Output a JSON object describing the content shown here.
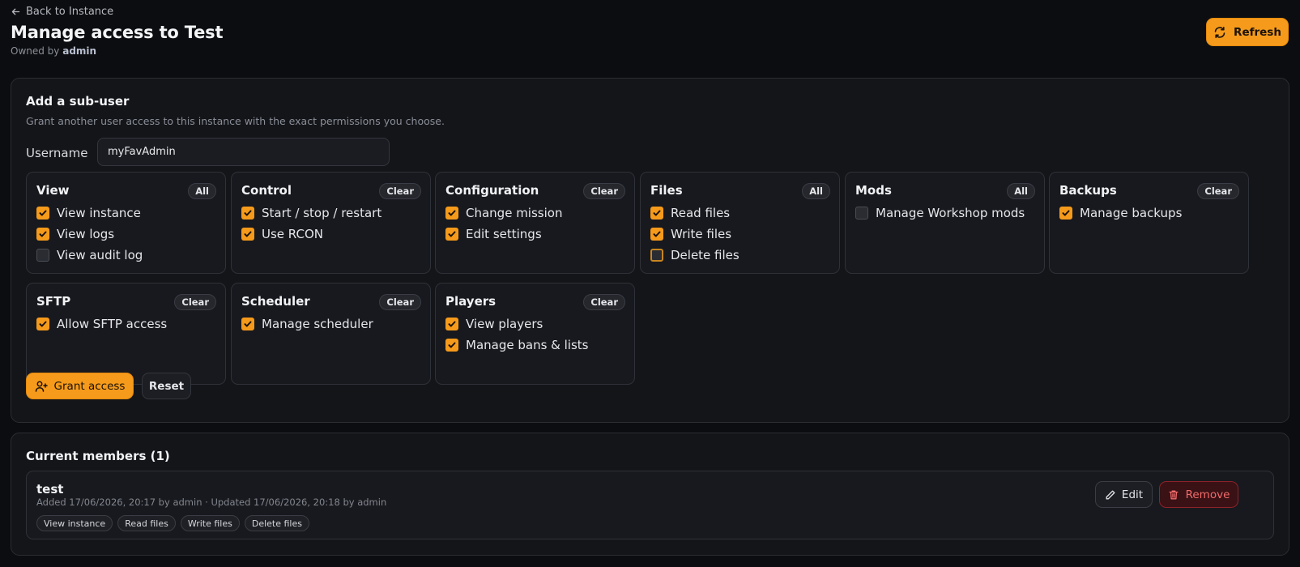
{
  "header": {
    "back_label": "Back to Instance",
    "title": "Manage access to Test",
    "owner_prefix": "Owned by",
    "owner_name": "admin",
    "refresh_label": "Refresh"
  },
  "colors": {
    "accent": "#f59a1b",
    "background": "#0c0d10",
    "danger": "#f26b6b"
  },
  "add_subuser": {
    "title": "Add a sub-user",
    "description": "Grant another user access to this instance with the exact permissions you choose.",
    "username_label": "Username",
    "username_value": "myFavAdmin",
    "grant_label": "Grant access",
    "reset_label": "Reset"
  },
  "permission_groups": [
    {
      "title": "View",
      "action": "All",
      "items": [
        {
          "label": "View instance",
          "checked": true
        },
        {
          "label": "View logs",
          "checked": true
        },
        {
          "label": "View audit log",
          "checked": false
        }
      ]
    },
    {
      "title": "Control",
      "action": "Clear",
      "items": [
        {
          "label": "Start / stop / restart",
          "checked": true
        },
        {
          "label": "Use RCON",
          "checked": true
        }
      ]
    },
    {
      "title": "Configuration",
      "action": "Clear",
      "items": [
        {
          "label": "Change mission",
          "checked": true
        },
        {
          "label": "Edit settings",
          "checked": true
        }
      ]
    },
    {
      "title": "Files",
      "action": "All",
      "items": [
        {
          "label": "Read files",
          "checked": true
        },
        {
          "label": "Write files",
          "checked": true
        },
        {
          "label": "Delete files",
          "checked": false
        }
      ]
    },
    {
      "title": "Mods",
      "action": "All",
      "items": [
        {
          "label": "Manage Workshop mods",
          "checked": false
        }
      ]
    },
    {
      "title": "Backups",
      "action": "Clear",
      "items": [
        {
          "label": "Manage backups",
          "checked": true
        }
      ]
    },
    {
      "title": "SFTP",
      "action": "Clear",
      "items": [
        {
          "label": "Allow SFTP access",
          "checked": true
        }
      ]
    },
    {
      "title": "Scheduler",
      "action": "Clear",
      "items": [
        {
          "label": "Manage scheduler",
          "checked": true
        }
      ]
    },
    {
      "title": "Players",
      "action": "Clear",
      "items": [
        {
          "label": "View players",
          "checked": true
        },
        {
          "label": "Manage bans & lists",
          "checked": true
        }
      ]
    }
  ],
  "members": {
    "title": "Current members (1)",
    "list": [
      {
        "name": "test",
        "meta": "Added 17/06/2026, 20:17 by admin · Updated 17/06/2026, 20:18 by admin",
        "tags": [
          "View instance",
          "Read files",
          "Write files",
          "Delete files"
        ],
        "edit_label": "Edit",
        "remove_label": "Remove"
      }
    ]
  }
}
